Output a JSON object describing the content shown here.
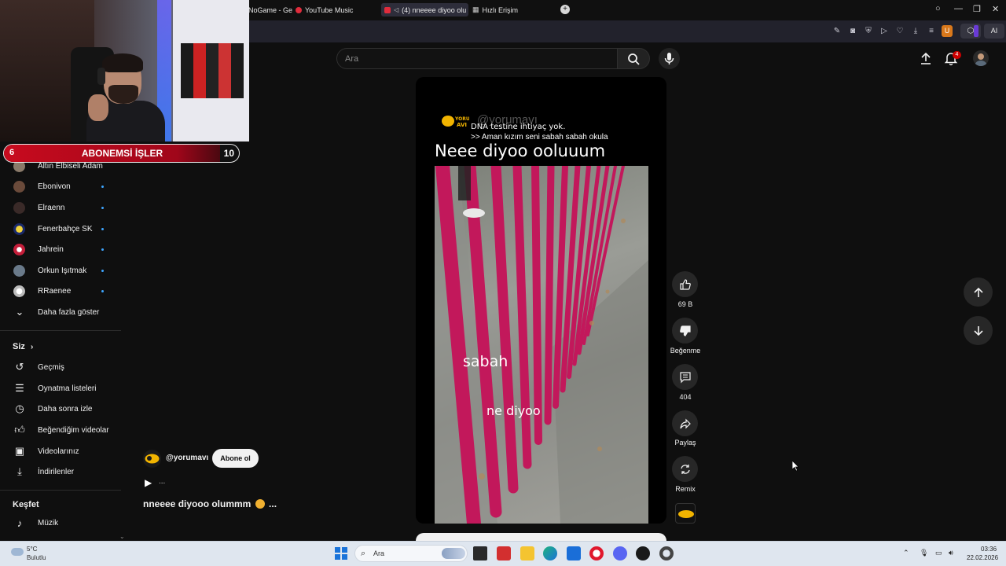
{
  "browser": {
    "tabs": [
      {
        "label": "NoGame - Gele",
        "active": false
      },
      {
        "label": "YouTube Music",
        "active": false
      },
      {
        "label": "(4) nneeee diyoo olu",
        "active": true
      },
      {
        "label": "Hızlı Erişim",
        "active": false
      }
    ],
    "new_tab": "+",
    "ext_u": "U",
    "ext_ai": "AI"
  },
  "overlay": {
    "goal_start": "6",
    "goal_title": "ABONEMSİ İŞLER",
    "goal_end": "10"
  },
  "sidebar": {
    "subscriptions": [
      {
        "label": "Altın Elbiseli Adam",
        "color": "#8a7a6a",
        "dot": false
      },
      {
        "label": "Ebonivon",
        "color": "#6a4a3a",
        "dot": true
      },
      {
        "label": "Elraenn",
        "color": "#3a2a28",
        "dot": true
      },
      {
        "label": "Fenerbahçe SK",
        "color": "#f2d43a",
        "dot": true
      },
      {
        "label": "Jahrein",
        "color": "#c41e3a",
        "dot": true
      },
      {
        "label": "Orkun Işıtmak",
        "color": "#6a7a8a",
        "dot": true
      },
      {
        "label": "RRaenee",
        "color": "#d0d0d0",
        "dot": true
      }
    ],
    "show_more": "Daha fazla göster",
    "you_heading": "Siz",
    "you_items": [
      {
        "label": "Geçmiş",
        "icon": "history-icon"
      },
      {
        "label": "Oynatma listeleri",
        "icon": "playlist-icon"
      },
      {
        "label": "Daha sonra izle",
        "icon": "clock-icon"
      },
      {
        "label": "Beğendiğim videolar",
        "icon": "thumbs-up-icon"
      },
      {
        "label": "Videolarınız",
        "icon": "video-icon"
      },
      {
        "label": "İndirilenler",
        "icon": "download-icon"
      }
    ],
    "explore_heading": "Keşfet",
    "explore_items": [
      {
        "label": "Müzik",
        "icon": "music-icon"
      }
    ]
  },
  "search": {
    "placeholder": "Ara"
  },
  "header": {
    "notifications_count": "4"
  },
  "short": {
    "watermark": "@yorumavı",
    "caption_line1": "DNA testine ihtiyaç yok.",
    "caption_line2": ">> Aman kızım seni sabah sabah okula",
    "title": "Neee diyoo ooluuum",
    "overlay_text1": "sabah",
    "overlay_text2": "ne diyoo"
  },
  "channel": {
    "handle": "@yorumavı",
    "subscribe_label": "Abone ol",
    "more_dots": "...",
    "video_title_start": "nneeee diyooo olummm",
    "video_title_end": "..."
  },
  "actions": {
    "like_count": "69 B",
    "dislike_label": "Beğenme",
    "comment_count": "404",
    "share_label": "Paylaş",
    "remix_label": "Remix"
  },
  "taskbar": {
    "temperature": "5°C",
    "weather": "Bulutlu",
    "search_label": "Ara",
    "time": "03:36",
    "date": "22.02.2026"
  }
}
